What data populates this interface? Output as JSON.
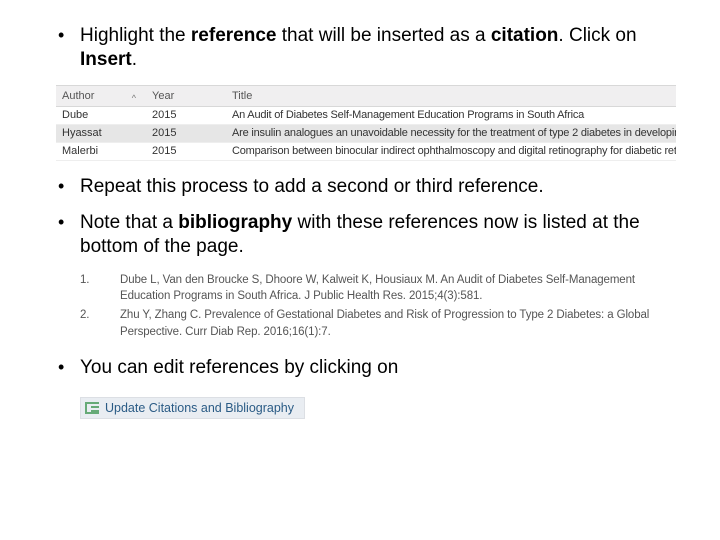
{
  "bullets": {
    "b1_pre": "Highlight the ",
    "b1_ref": "reference",
    "b1_mid": " that will be inserted as a ",
    "b1_cit": "citation",
    "b1_post1": ".  Click on ",
    "b1_ins": "Insert",
    "b1_post2": ".",
    "b2": "Repeat this process to add a second or third reference.",
    "b3_pre": "Note that a ",
    "b3_bib": "bibliography",
    "b3_post": " with these references now is listed at the bottom of the page.",
    "b4": "You can edit references by clicking on"
  },
  "ref_table": {
    "headers": {
      "author": "Author",
      "year": "Year",
      "title": "Title"
    },
    "rows": [
      {
        "author": "Dube",
        "year": "2015",
        "title": "An Audit of Diabetes Self-Management Education Programs in South Africa"
      },
      {
        "author": "Hyassat",
        "year": "2015",
        "title": "Are insulin analogues an unavoidable necessity for the treatment of type 2 diabetes in developing countries? The case"
      },
      {
        "author": "Malerbi",
        "year": "2015",
        "title": "Comparison between binocular indirect ophthalmoscopy and digital retinography for diabetic retinopathy screening: th"
      }
    ]
  },
  "bibliography": [
    {
      "num": "1.",
      "text": "Dube L, Van den Broucke S, Dhoore W, Kalweit K, Housiaux M. An Audit of Diabetes Self-Management Education Programs in South Africa. J Public Health Res. 2015;4(3):581."
    },
    {
      "num": "2.",
      "text": "Zhu Y, Zhang C. Prevalence of Gestational Diabetes and Risk of Progression to Type 2 Diabetes: a Global Perspective. Curr Diab Rep. 2016;16(1):7."
    }
  ],
  "update_button": {
    "label": "Update Citations and Bibliography"
  }
}
